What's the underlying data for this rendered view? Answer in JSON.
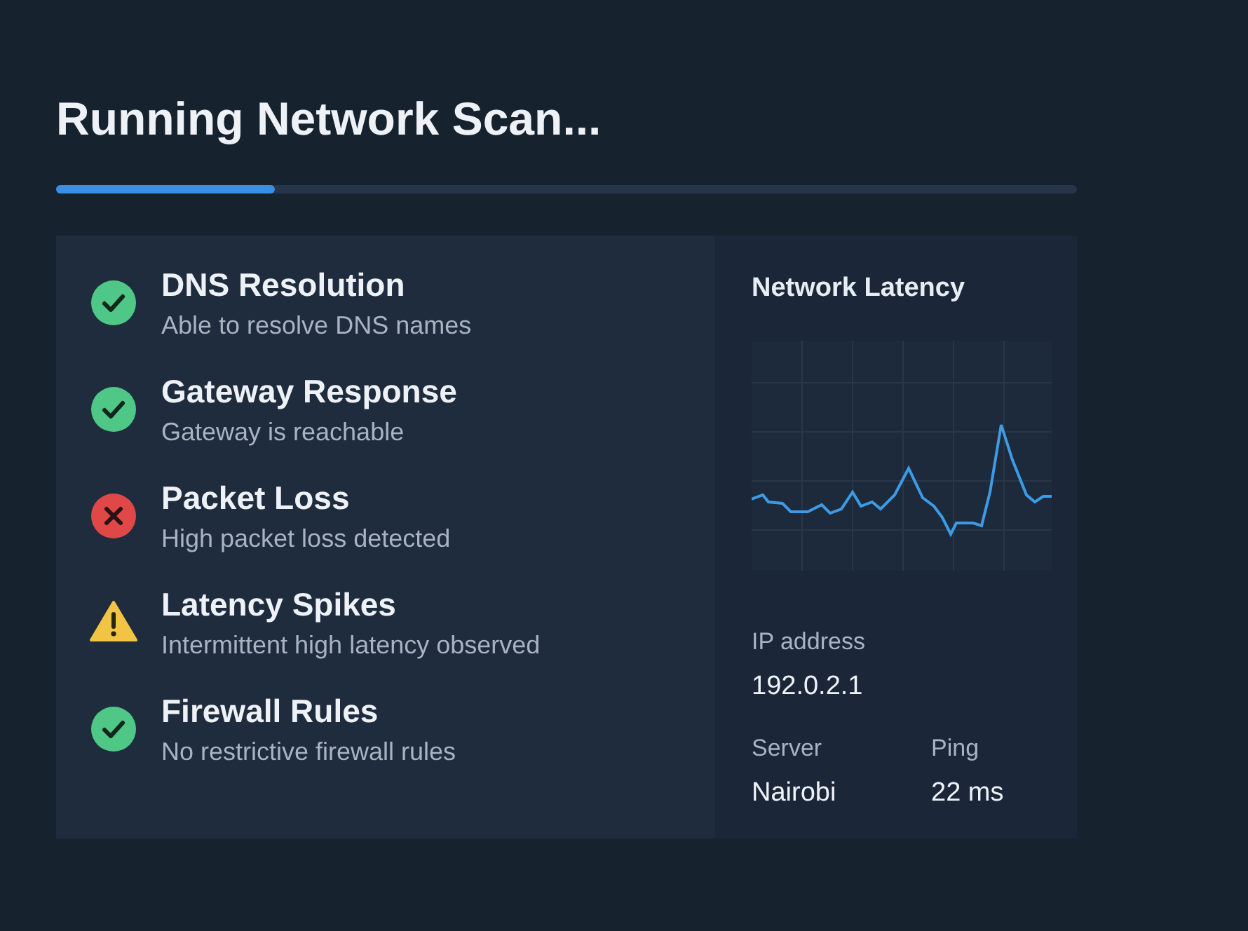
{
  "title": "Running Network Scan...",
  "progress": {
    "level": 0.214
  },
  "checks": [
    {
      "title": "DNS Resolution",
      "subtitle": "Able to resolve DNS names",
      "kind": "ok"
    },
    {
      "title": "Gateway Response",
      "subtitle": "Gateway is reachable",
      "kind": "ok"
    },
    {
      "title": "Packet Loss",
      "subtitle": "High packet loss detected",
      "kind": "error"
    },
    {
      "title": "Latency Spikes",
      "subtitle": "Intermittent high latency observed",
      "kind": "warning"
    },
    {
      "title": "Firewall Rules",
      "subtitle": "No restrictive firewall rules",
      "kind": "ok"
    }
  ],
  "latency_panel": {
    "title": "Network Latency",
    "ip_label": "IP address",
    "ip_value": "192.0.2.1",
    "server_label": "Server",
    "server_value": "Nairobi",
    "ping_label": "Ping",
    "ping_value": "22 ms"
  }
}
